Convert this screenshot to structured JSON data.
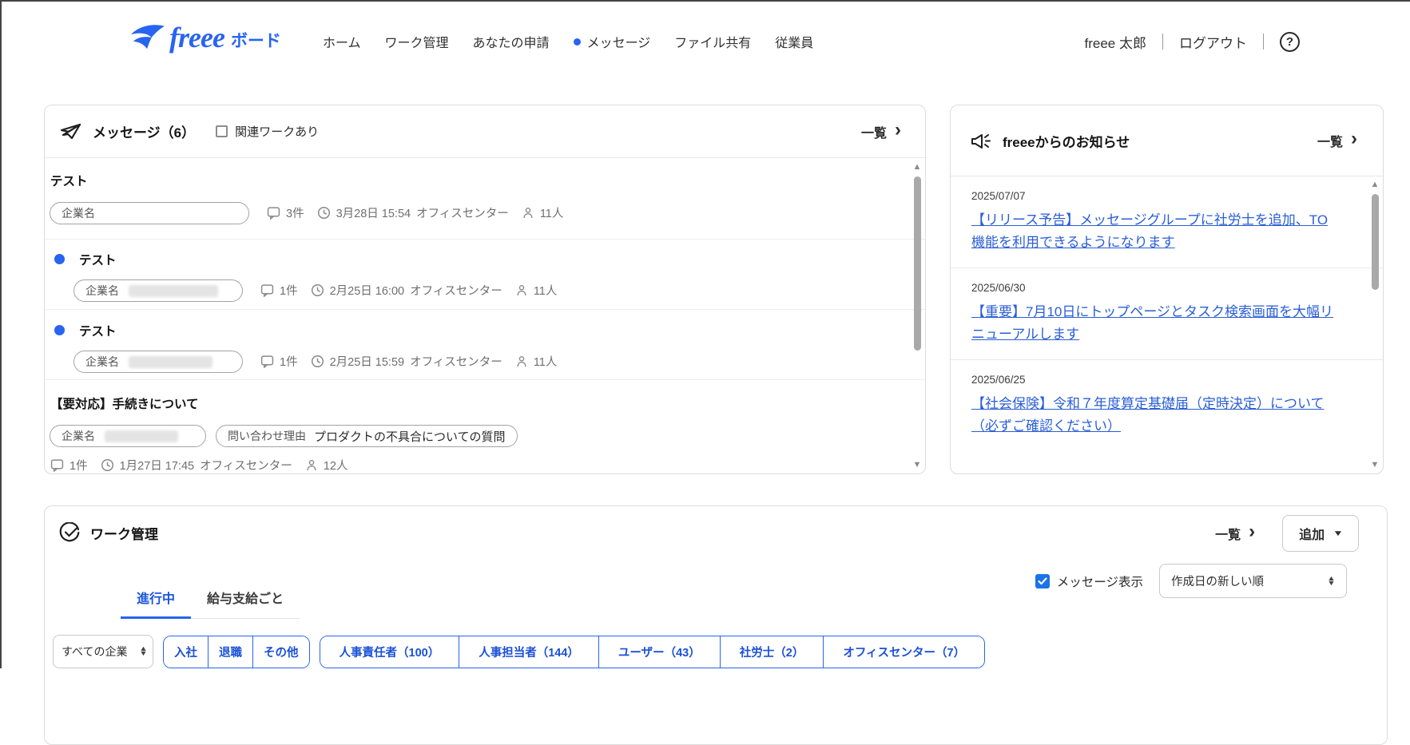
{
  "colors": {
    "brand_blue": "#2864F0",
    "link_blue": "#2A5ED6",
    "checkbox_blue": "#1A73E8",
    "tab_active_blue": "#1A56DB"
  },
  "icons": {
    "chevron_right": "›",
    "caret_down": "▼",
    "caret_up": "▲",
    "scroll_up": "▲",
    "scroll_down": "▼",
    "help": "?"
  },
  "header": {
    "logo_text": "freee",
    "logo_suffix": "ボード",
    "nav": [
      {
        "label": "ホーム"
      },
      {
        "label": "ワーク管理"
      },
      {
        "label": "あなたの申請"
      },
      {
        "label": "メッセージ",
        "dot": true
      },
      {
        "label": "ファイル共有"
      },
      {
        "label": "従業員"
      }
    ],
    "user_name": "freee 太郎",
    "logout_label": "ログアウト"
  },
  "messages_panel": {
    "title": "メッセージ（6）",
    "filter_checkbox_label": "関連ワークあり",
    "filter_checkbox_checked": false,
    "list_link_label": "一覧",
    "items": [
      {
        "unread": false,
        "title": "テスト",
        "company_label": "企業名",
        "count": "3件",
        "datetime": "3月28日 15:54",
        "handler": "オフィスセンター",
        "members": "11人"
      },
      {
        "unread": true,
        "title": "テスト",
        "company_label": "企業名",
        "count": "1件",
        "datetime": "2月25日 16:00",
        "handler": "オフィスセンター",
        "members": "11人"
      },
      {
        "unread": true,
        "title": "テスト",
        "company_label": "企業名",
        "count": "1件",
        "datetime": "2月25日 15:59",
        "handler": "オフィスセンター",
        "members": "11人"
      },
      {
        "unread": false,
        "title": "【要対応】手続きについて",
        "company_label": "企業名",
        "reason_label": "問い合わせ理由",
        "reason_value": "プロダクトの不具合についての質問",
        "count": "1件",
        "datetime": "1月27日 17:45",
        "handler": "オフィスセンター",
        "members": "12人"
      }
    ]
  },
  "news_panel": {
    "title": "freeeからのお知らせ",
    "list_link_label": "一覧",
    "items": [
      {
        "date": "2025/07/07",
        "title": "【リリース予告】メッセージグループに社労士を追加、TO機能を利用できるようになります"
      },
      {
        "date": "2025/06/30",
        "title": "【重要】7月10日にトップページとタスク検索画面を大幅リニューアルします"
      },
      {
        "date": "2025/06/25",
        "title": "【社会保険】令和７年度算定基礎届（定時決定）について（必ずご確認ください）"
      }
    ]
  },
  "work_panel": {
    "title": "ワーク管理",
    "list_link_label": "一覧",
    "add_button_label": "追加",
    "tabs": [
      {
        "label": "進行中",
        "active": true
      },
      {
        "label": "給与支給ごと",
        "active": false
      }
    ],
    "message_display_label": "メッセージ表示",
    "message_display_checked": true,
    "sort_select_value": "作成日の新しい順",
    "company_select_value": "すべての企業",
    "status_filters": [
      "入社",
      "退職",
      "その他"
    ],
    "role_filters": [
      "人事責任者（100）",
      "人事担当者（144）",
      "ユーザー（43）",
      "社労士（2）",
      "オフィスセンター（7）"
    ]
  }
}
